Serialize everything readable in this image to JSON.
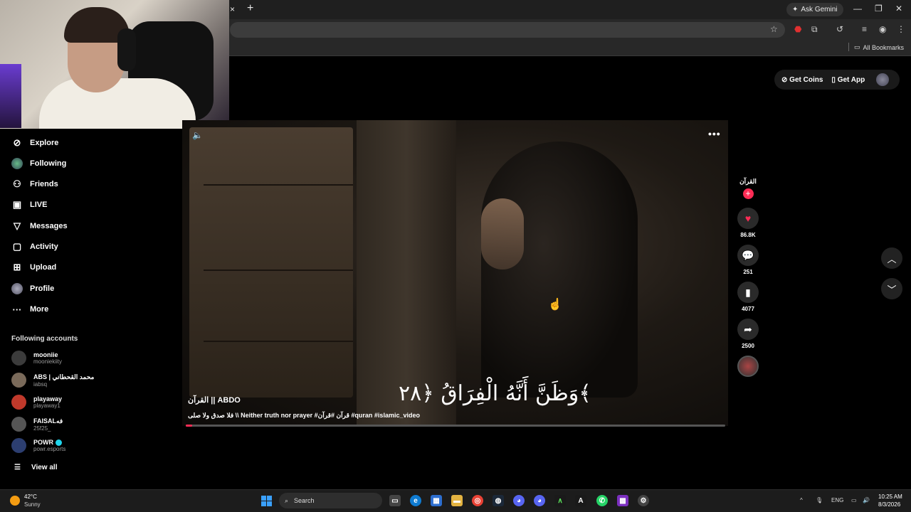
{
  "browser": {
    "tab_close": "×",
    "tab_new": "+",
    "ask_gemini": "Ask Gemini",
    "all_bookmarks": "All Bookmarks",
    "window_controls": [
      "—",
      "❐",
      "✕"
    ]
  },
  "sidebar": {
    "items": [
      {
        "label": "Explore",
        "icon": "compass-icon"
      },
      {
        "label": "Following",
        "icon": "following-avatar"
      },
      {
        "label": "Friends",
        "icon": "friends-icon"
      },
      {
        "label": "LIVE",
        "icon": "live-icon"
      },
      {
        "label": "Messages",
        "icon": "messages-icon"
      },
      {
        "label": "Activity",
        "icon": "activity-icon"
      },
      {
        "label": "Upload",
        "icon": "upload-icon"
      },
      {
        "label": "Profile",
        "icon": "profile-avatar"
      },
      {
        "label": "More",
        "icon": "more-icon"
      }
    ],
    "following_title": "Following accounts",
    "accounts": [
      {
        "name": "mooniie",
        "handle": "mooniekiity",
        "color": "#3b3b3b"
      },
      {
        "name": "ABS | محمد القحطاني",
        "handle": "iabsq",
        "color": "#7a6a5a"
      },
      {
        "name": "playaway",
        "handle": "playaway1",
        "color": "#c0392b"
      },
      {
        "name": "FAISALفه",
        "handle": "25f25_",
        "color": "#555555"
      },
      {
        "name": "POWR",
        "handle": "powr.esports",
        "color": "#2c3e70",
        "verified": true
      }
    ],
    "view_all": "View all"
  },
  "topbar": {
    "get_coins": "Get Coins",
    "get_app": "Get App"
  },
  "video": {
    "author": "القرآن || ABDO",
    "caption": "فلا صدق ولا صلى \\\\ Neither truth nor prayer #قرآن #قرآن #quran #islamic_video",
    "overlay_text": "وَظَنَّ أَنَّهُ الْفِرَاقُ ﴿٢٨﴾",
    "progress": 0.012,
    "accent_color": "#fe2c55"
  },
  "actions": {
    "creator_label": "القرآن",
    "likes": "86.8K",
    "comments": "251",
    "saves": "4077",
    "shares": "2500"
  },
  "taskbar": {
    "temperature": "42°C",
    "condition": "Sunny",
    "search_placeholder": "Search",
    "language": "ENG",
    "time": "10:25 AM",
    "date": "8/3/2026"
  }
}
